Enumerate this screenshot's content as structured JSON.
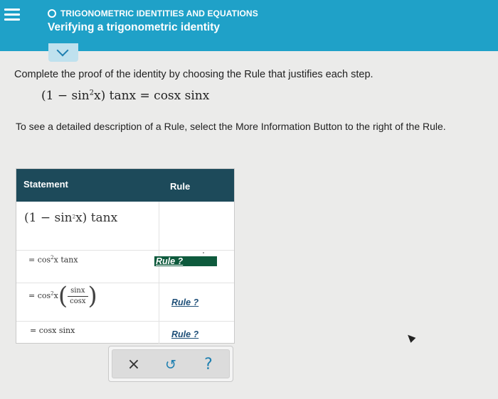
{
  "header": {
    "topic": "TRIGONOMETRIC IDENTITIES AND EQUATIONS",
    "title": "Verifying a trigonometric identity",
    "menu_icon": "hamburger-menu-icon",
    "topic_icon": "circle-outline-icon",
    "background_color": "#1fa1c8"
  },
  "collapse": {
    "icon": "chevron-down-icon"
  },
  "instructions": {
    "line1": "Complete the proof of the identity by choosing the Rule that justifies each step.",
    "identity": {
      "open": "(1 − sin",
      "exp": "2",
      "close": "x) tanx = cosx sinx"
    },
    "line2": "To see a detailed description of a Rule, select the More Information Button to the right of the Rule."
  },
  "table": {
    "header_statement": "Statement",
    "header_rule": "Rule",
    "header_color": "#1d4a5a",
    "rows": [
      {
        "s_prefix": "(1 − sin",
        "s_exp": "2",
        "s_suffix": "x) tanx",
        "rule": ""
      },
      {
        "s_prefix": "= cos",
        "s_exp": "2",
        "s_suffix": "x tanx",
        "rule": "Rule ?"
      },
      {
        "s_prefix": "= cos",
        "s_exp": "2",
        "s_suffix": "x",
        "frac_num": "sinx",
        "frac_den": "cosx",
        "rule": "Rule ?"
      },
      {
        "s_prefix": "= cosx sinx",
        "rule": "Rule ?"
      }
    ],
    "active_rule_color": "#0e5a3d"
  },
  "toolbar": {
    "clear_label": "×",
    "clear_icon": "close-icon",
    "undo_label": "↺",
    "undo_icon": "undo-icon",
    "help_label": "?",
    "help_icon": "question-mark-icon"
  }
}
